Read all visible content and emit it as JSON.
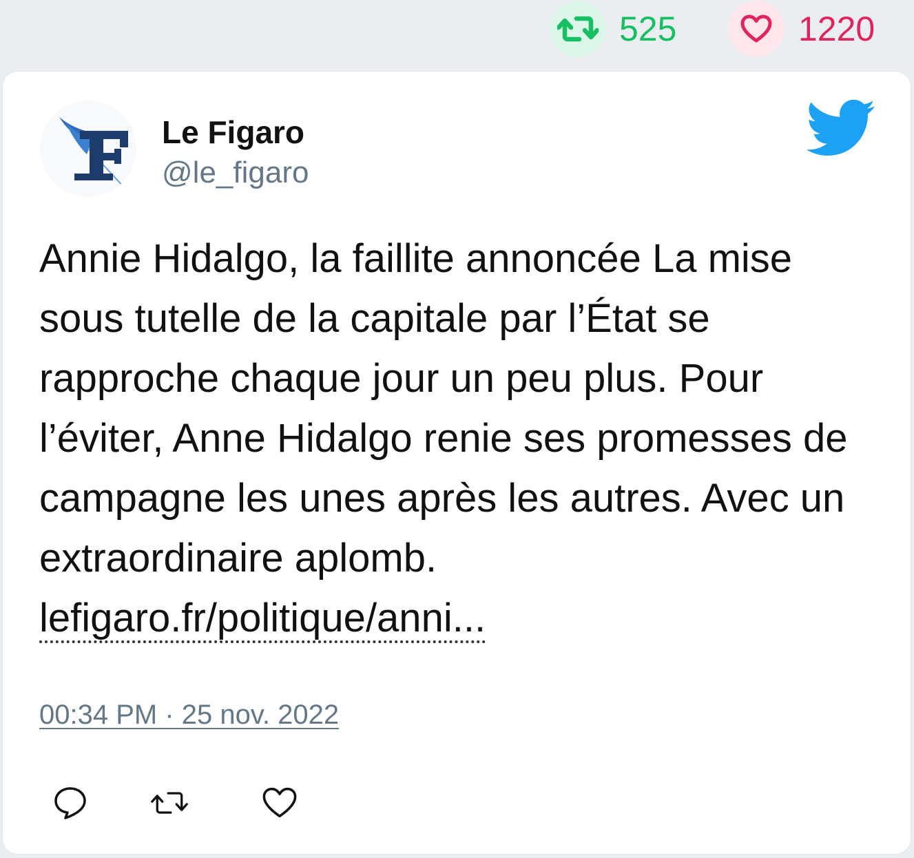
{
  "stats": {
    "retweets": "525",
    "likes": "1220"
  },
  "author": {
    "name": "Le Figaro",
    "handle": "@le_figaro",
    "avatar_icon": "le-figaro-logo"
  },
  "tweet": {
    "text": "Annie Hidalgo, la faillite annoncée La mise sous tutelle de la capitale par l’État se rapproche chaque jour un peu plus. Pour l’éviter, Anne Hidalgo renie ses promesses de campagne les unes après les autres. Avec un extraordinaire aplomb. ",
    "link": "lefigaro.fr/politique/anni...",
    "timestamp": "00:34 PM · 25 nov. 2022"
  },
  "actions": [
    {
      "name": "reply",
      "icon": "comment-icon"
    },
    {
      "name": "retweet",
      "icon": "retweet-icon"
    },
    {
      "name": "like",
      "icon": "heart-icon"
    }
  ],
  "colors": {
    "background": "#ebeef0",
    "retweet": "#17bf63",
    "like": "#e0245e",
    "twitter_blue": "#1da1f2",
    "secondary_text": "#657786"
  }
}
